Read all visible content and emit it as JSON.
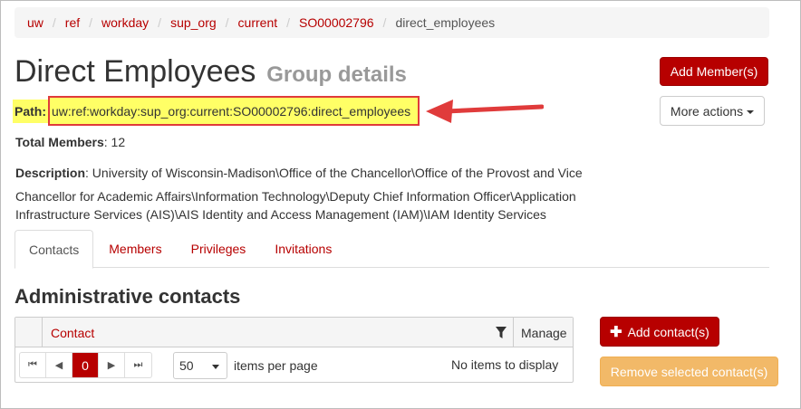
{
  "breadcrumb": {
    "items": [
      "uw",
      "ref",
      "workday",
      "sup_org",
      "current",
      "SO00002796"
    ],
    "current": "direct_employees"
  },
  "header": {
    "title": "Direct Employees",
    "subtitle": "Group details"
  },
  "path": {
    "label": "Path",
    "value": "uw:ref:workday:sup_org:current:SO00002796:direct_employees"
  },
  "total_members": {
    "label": "Total Members",
    "value": "12"
  },
  "description": {
    "label": "Description",
    "line1": "University of Wisconsin-Madison\\Office of the Chancellor\\Office of the Provost and Vice",
    "line2": "Chancellor for Academic Affairs\\Information Technology\\Deputy Chief Information Officer\\Application",
    "line3": "Infrastructure Services (AIS)\\AIS Identity and Access Management (IAM)\\IAM Identity Services"
  },
  "actions": {
    "add_member": "Add Member(s)",
    "more_actions": "More actions"
  },
  "tabs": [
    {
      "label": "Contacts",
      "active": true
    },
    {
      "label": "Members",
      "active": false
    },
    {
      "label": "Privileges",
      "active": false
    },
    {
      "label": "Invitations",
      "active": false
    }
  ],
  "contacts": {
    "title": "Administrative contacts",
    "columns": {
      "contact": "Contact",
      "manage": "Manage"
    },
    "pager": {
      "first": "⏮",
      "prev": "◀",
      "page": "0",
      "next": "▶",
      "last": "⏭"
    },
    "per_page_value": "50",
    "per_page_label": "items per page",
    "empty_text": "No items to display",
    "add_contact": "Add contact(s)",
    "remove_selected": "Remove selected contact(s)"
  },
  "colors": {
    "accent": "#b70000",
    "highlight": "#ffff66",
    "annotation": "#e03b3b",
    "warning": "#f0ad4e"
  }
}
